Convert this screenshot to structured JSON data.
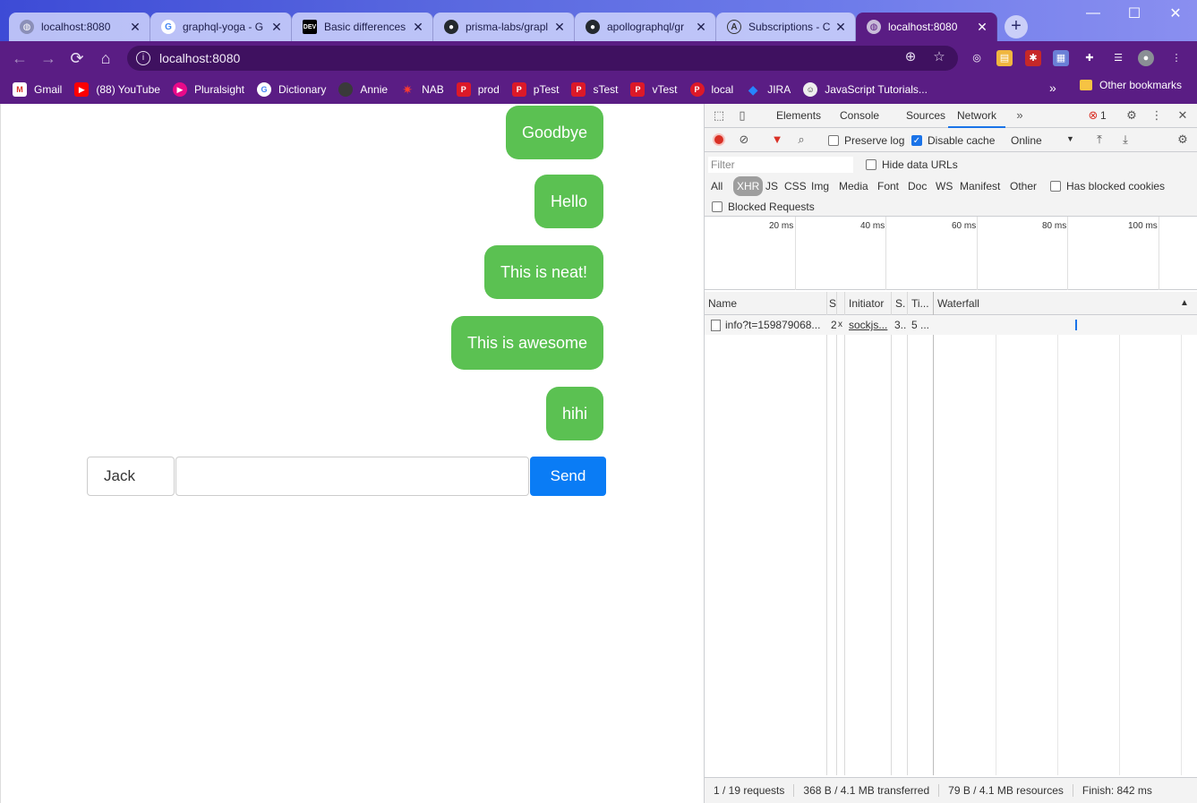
{
  "browser": {
    "tabs": [
      {
        "title": "localhost:8080",
        "icon": "globe-icon",
        "active": false
      },
      {
        "title": "graphql-yoga - G",
        "icon": "google-icon",
        "active": false
      },
      {
        "title": "Basic differences",
        "icon": "dev-icon",
        "active": false
      },
      {
        "title": "prisma-labs/grapl",
        "icon": "github-icon",
        "active": false
      },
      {
        "title": "apollographql/gr",
        "icon": "github-icon",
        "active": false
      },
      {
        "title": "Subscriptions - C",
        "icon": "apollo-icon",
        "active": false
      },
      {
        "title": "localhost:8080",
        "icon": "globe-icon",
        "active": true
      }
    ],
    "tab_close": "✕",
    "new_tab": "+",
    "window_controls": {
      "minimize": "—",
      "maximize": "☐",
      "close": "✕"
    },
    "address": "localhost:8080",
    "bookmarks": [
      {
        "label": "Gmail",
        "icon": "gmail-icon",
        "color": "#d93025"
      },
      {
        "label": "(88) YouTube",
        "icon": "youtube-icon",
        "color": "#ff0000"
      },
      {
        "label": "Pluralsight",
        "icon": "pluralsight-icon",
        "color": "#e80a89"
      },
      {
        "label": "Dictionary",
        "icon": "google-icon",
        "color": "#ffffff"
      },
      {
        "label": "Annie",
        "icon": "annie-icon",
        "color": "#333333"
      },
      {
        "label": "NAB",
        "icon": "nab-icon",
        "color": "#d93025"
      },
      {
        "label": "prod",
        "icon": "auspost-icon",
        "color": "#dc1928"
      },
      {
        "label": "pTest",
        "icon": "auspost-icon",
        "color": "#dc1928"
      },
      {
        "label": "sTest",
        "icon": "auspost-icon",
        "color": "#dc1928"
      },
      {
        "label": "vTest",
        "icon": "auspost-icon",
        "color": "#dc1928"
      },
      {
        "label": "local",
        "icon": "auspost-icon",
        "color": "#dc1928"
      },
      {
        "label": "JIRA",
        "icon": "jira-icon",
        "color": "#2684ff"
      },
      {
        "label": "JavaScript Tutorials...",
        "icon": "js-tutorials-icon",
        "color": "#eeeeee"
      }
    ],
    "bookmarks_more": "»",
    "other_bookmarks": "Other bookmarks"
  },
  "chat": {
    "messages": [
      "Goodbye",
      "Hello",
      "This is neat!",
      "This is awesome",
      "hihi"
    ],
    "bubble_color": "#5bc152",
    "name_value": "Jack",
    "message_value": "",
    "send_label": "Send",
    "send_color": "#0a7cf5"
  },
  "devtools": {
    "tabs": [
      "Elements",
      "Console",
      "Sources",
      "Network"
    ],
    "active_tab": "Network",
    "more_tabs": "»",
    "error_count": "1",
    "preserve_log": "Preserve log",
    "disable_cache": "Disable cache",
    "throttle": "Online",
    "filter_placeholder": "Filter",
    "hide_data_urls": "Hide data URLs",
    "types": [
      "All",
      "XHR",
      "JS",
      "CSS",
      "Img",
      "Media",
      "Font",
      "Doc",
      "WS",
      "Manifest",
      "Other"
    ],
    "active_type": "XHR",
    "has_blocked_cookies": "Has blocked cookies",
    "blocked_requests": "Blocked Requests",
    "timeline_ticks": [
      "20 ms",
      "40 ms",
      "60 ms",
      "80 ms",
      "100 ms"
    ],
    "columns": [
      "Name",
      "S",
      "Initiator",
      "S.",
      "Ti...",
      "Waterfall"
    ],
    "sort_indicator": "▲",
    "rows": [
      {
        "name": "info?t=159879068...",
        "status": "2",
        "type": "x",
        "initiator": "sockjs...",
        "size": "3...",
        "time": "5 ..."
      }
    ],
    "status": {
      "requests": "1 / 19 requests",
      "transferred": "368 B / 4.1 MB transferred",
      "resources": "79 B / 4.1 MB resources",
      "finish": "Finish: 842 ms"
    }
  }
}
